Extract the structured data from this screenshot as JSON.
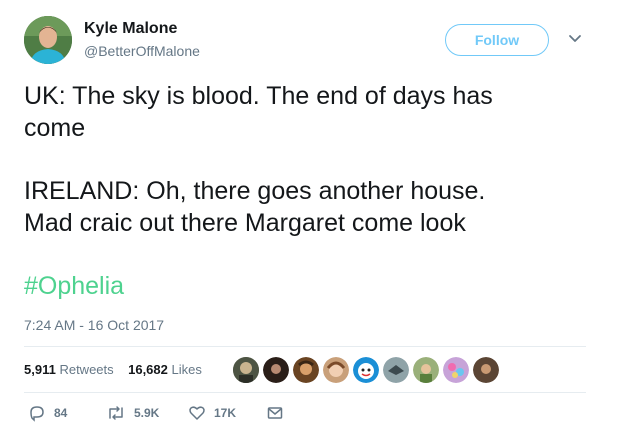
{
  "author": {
    "name": "Kyle Malone",
    "handle": "@BetterOffMalone"
  },
  "follow_label": "Follow",
  "tweet": {
    "lines_1": [
      "UK: The sky is blood. The end of days has",
      "come"
    ],
    "lines_2": [
      "IRELAND: Oh, there goes another house.",
      "Mad craic out there Margaret come look"
    ],
    "hashtag": "#Ophelia"
  },
  "timestamp": "7:24 AM - 16 Oct 2017",
  "stats": {
    "retweets_count": "5,911",
    "retweets_label": "Retweets",
    "likes_count": "16,682",
    "likes_label": "Likes"
  },
  "liker_avatars": [
    "avatar-1",
    "avatar-2",
    "avatar-3",
    "avatar-4",
    "avatar-5",
    "avatar-6",
    "avatar-7",
    "avatar-8",
    "avatar-9"
  ],
  "actions": {
    "replies": "84",
    "retweets": "5.9K",
    "likes": "17K"
  },
  "colors": {
    "accent": "#71c9f8",
    "hashtag": "#4ed28f",
    "muted": "#657786"
  }
}
